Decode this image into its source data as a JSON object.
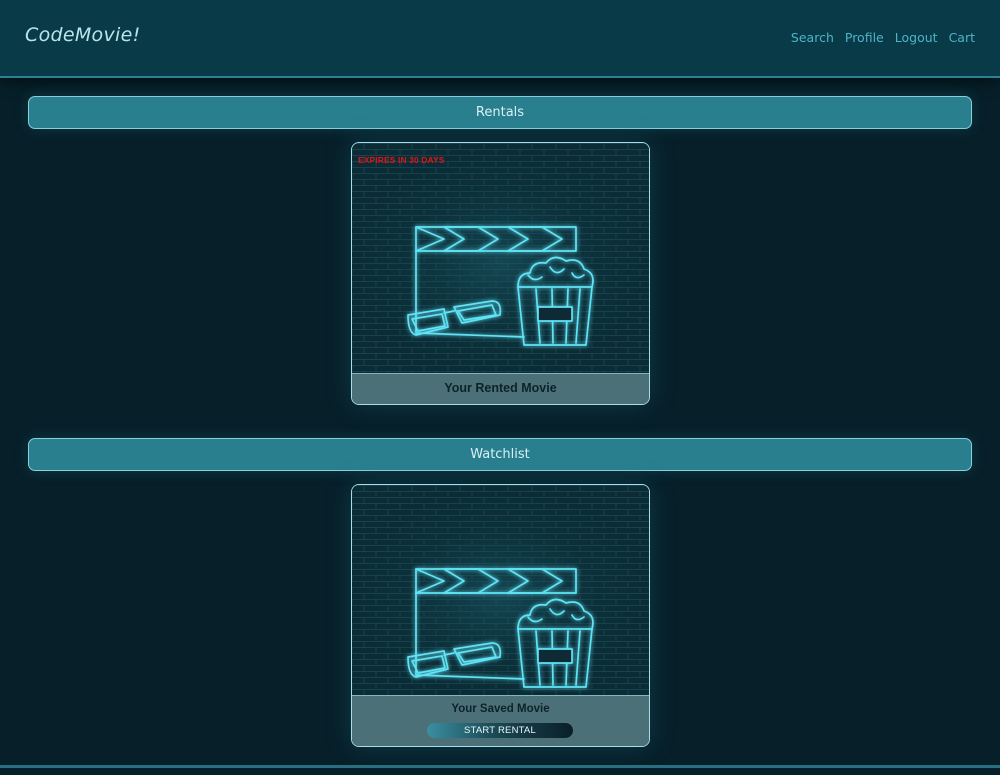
{
  "brand": "CodeMovie!",
  "nav": {
    "links": [
      "Search",
      "Profile",
      "Logout",
      "Cart"
    ]
  },
  "rentals": {
    "heading": "Rentals",
    "card": {
      "expires": "EXPIRES IN 30 DAYS",
      "title": "Your Rented Movie"
    }
  },
  "watchlist": {
    "heading": "Watchlist",
    "card": {
      "title": "Your Saved Movie",
      "button": "START RENTAL"
    }
  },
  "colors": {
    "background": "#071f29",
    "navbar": "#083a48",
    "section_bar": "#2a7f8f",
    "neon": "#3fdcf2",
    "expires_text": "#e01414"
  }
}
